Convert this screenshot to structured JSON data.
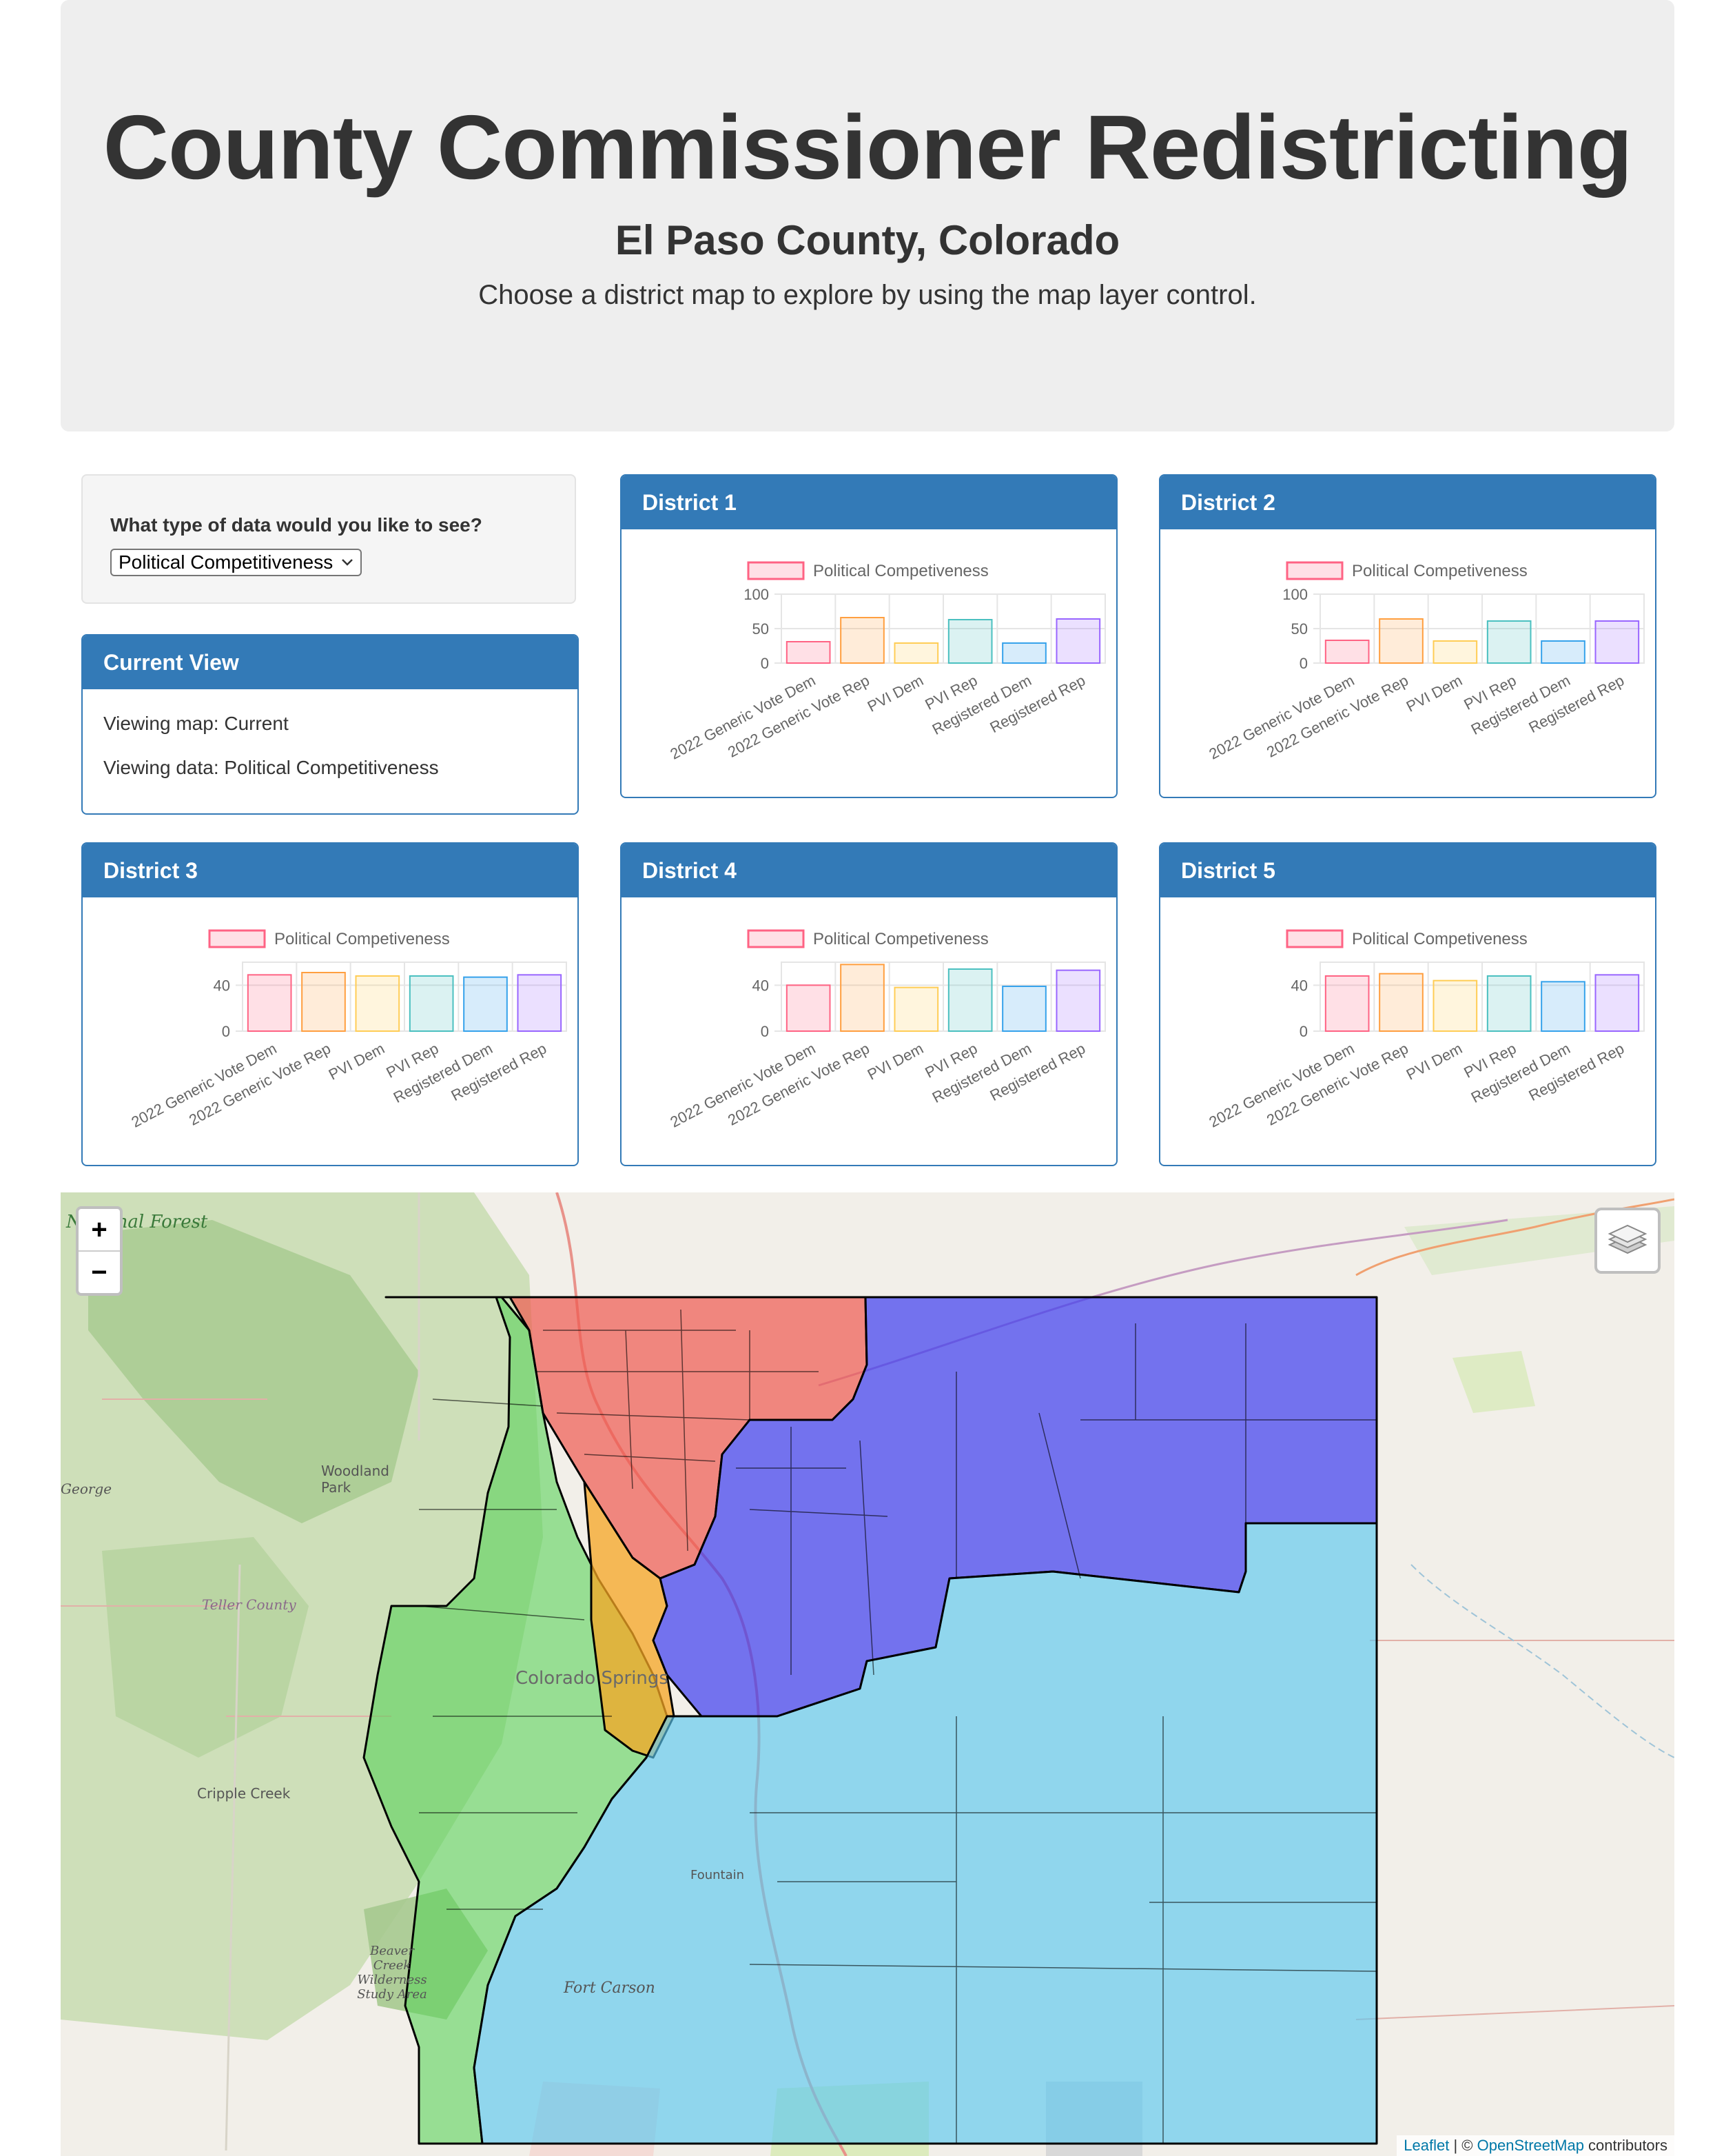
{
  "header": {
    "title": "County Commissioner Redistricting",
    "subtitle": "El Paso County, Colorado",
    "instructions": "Choose a district map to explore by using the map layer control."
  },
  "controls": {
    "question": "What type of data would you like to see?",
    "selected": "Political Competitiveness"
  },
  "current_view": {
    "heading": "Current View",
    "map_line": "Viewing map: Current",
    "data_line": "Viewing data: Political Competitiveness"
  },
  "colors": {
    "panel": "#337ab7",
    "district1": "#f05a50",
    "district2": "#7fe45a",
    "district3": "#f5a623",
    "district4": "#3d3df0",
    "district5": "#5ac8f0"
  },
  "chart_data": [
    {
      "type": "bar",
      "title": "District 1",
      "legend": "Political Competiveness",
      "categories": [
        "2022 Generic Vote Dem",
        "2022 Generic Vote Rep",
        "PVI Dem",
        "PVI Rep",
        "Registered Dem",
        "Registered Rep"
      ],
      "values": [
        31,
        66,
        29,
        63,
        29,
        64
      ],
      "ylim": [
        0,
        100
      ],
      "yticks": [
        0,
        50,
        100
      ]
    },
    {
      "type": "bar",
      "title": "District 2",
      "legend": "Political Competiveness",
      "categories": [
        "2022 Generic Vote Dem",
        "2022 Generic Vote Rep",
        "PVI Dem",
        "PVI Rep",
        "Registered Dem",
        "Registered Rep"
      ],
      "values": [
        33,
        64,
        32,
        61,
        32,
        61
      ],
      "ylim": [
        0,
        100
      ],
      "yticks": [
        0,
        50,
        100
      ]
    },
    {
      "type": "bar",
      "title": "District 3",
      "legend": "Political Competiveness",
      "categories": [
        "2022 Generic Vote Dem",
        "2022 Generic Vote Rep",
        "PVI Dem",
        "PVI Rep",
        "Registered Dem",
        "Registered Rep"
      ],
      "values": [
        49,
        51,
        48,
        48,
        47,
        49
      ],
      "ylim": [
        0,
        60
      ],
      "yticks": [
        0,
        40
      ]
    },
    {
      "type": "bar",
      "title": "District 4",
      "legend": "Political Competiveness",
      "categories": [
        "2022 Generic Vote Dem",
        "2022 Generic Vote Rep",
        "PVI Dem",
        "PVI Rep",
        "Registered Dem",
        "Registered Rep"
      ],
      "values": [
        40,
        58,
        38,
        54,
        39,
        53
      ],
      "ylim": [
        0,
        60
      ],
      "yticks": [
        0,
        40
      ]
    },
    {
      "type": "bar",
      "title": "District 5",
      "legend": "Political Competiveness",
      "categories": [
        "2022 Generic Vote Dem",
        "2022 Generic Vote Rep",
        "PVI Dem",
        "PVI Rep",
        "Registered Dem",
        "Registered Rep"
      ],
      "values": [
        48,
        50,
        44,
        48,
        43,
        49
      ],
      "ylim": [
        0,
        60
      ],
      "yticks": [
        0,
        40
      ]
    }
  ],
  "map": {
    "zoom_in": "+",
    "zoom_out": "−",
    "layers_icon": "layers-icon",
    "labels": [
      "Fort Carson",
      "Cripple Creek",
      "Teller County",
      "Woodland Park",
      "Beaver Creek Wilderness Study Area",
      "Colorado Springs",
      "Fountain",
      "George",
      "National Forest"
    ],
    "attribution_leaflet": "Leaflet",
    "attribution_sep": " | © ",
    "attribution_osm": "OpenStreetMap",
    "attribution_tail": " contributors"
  }
}
